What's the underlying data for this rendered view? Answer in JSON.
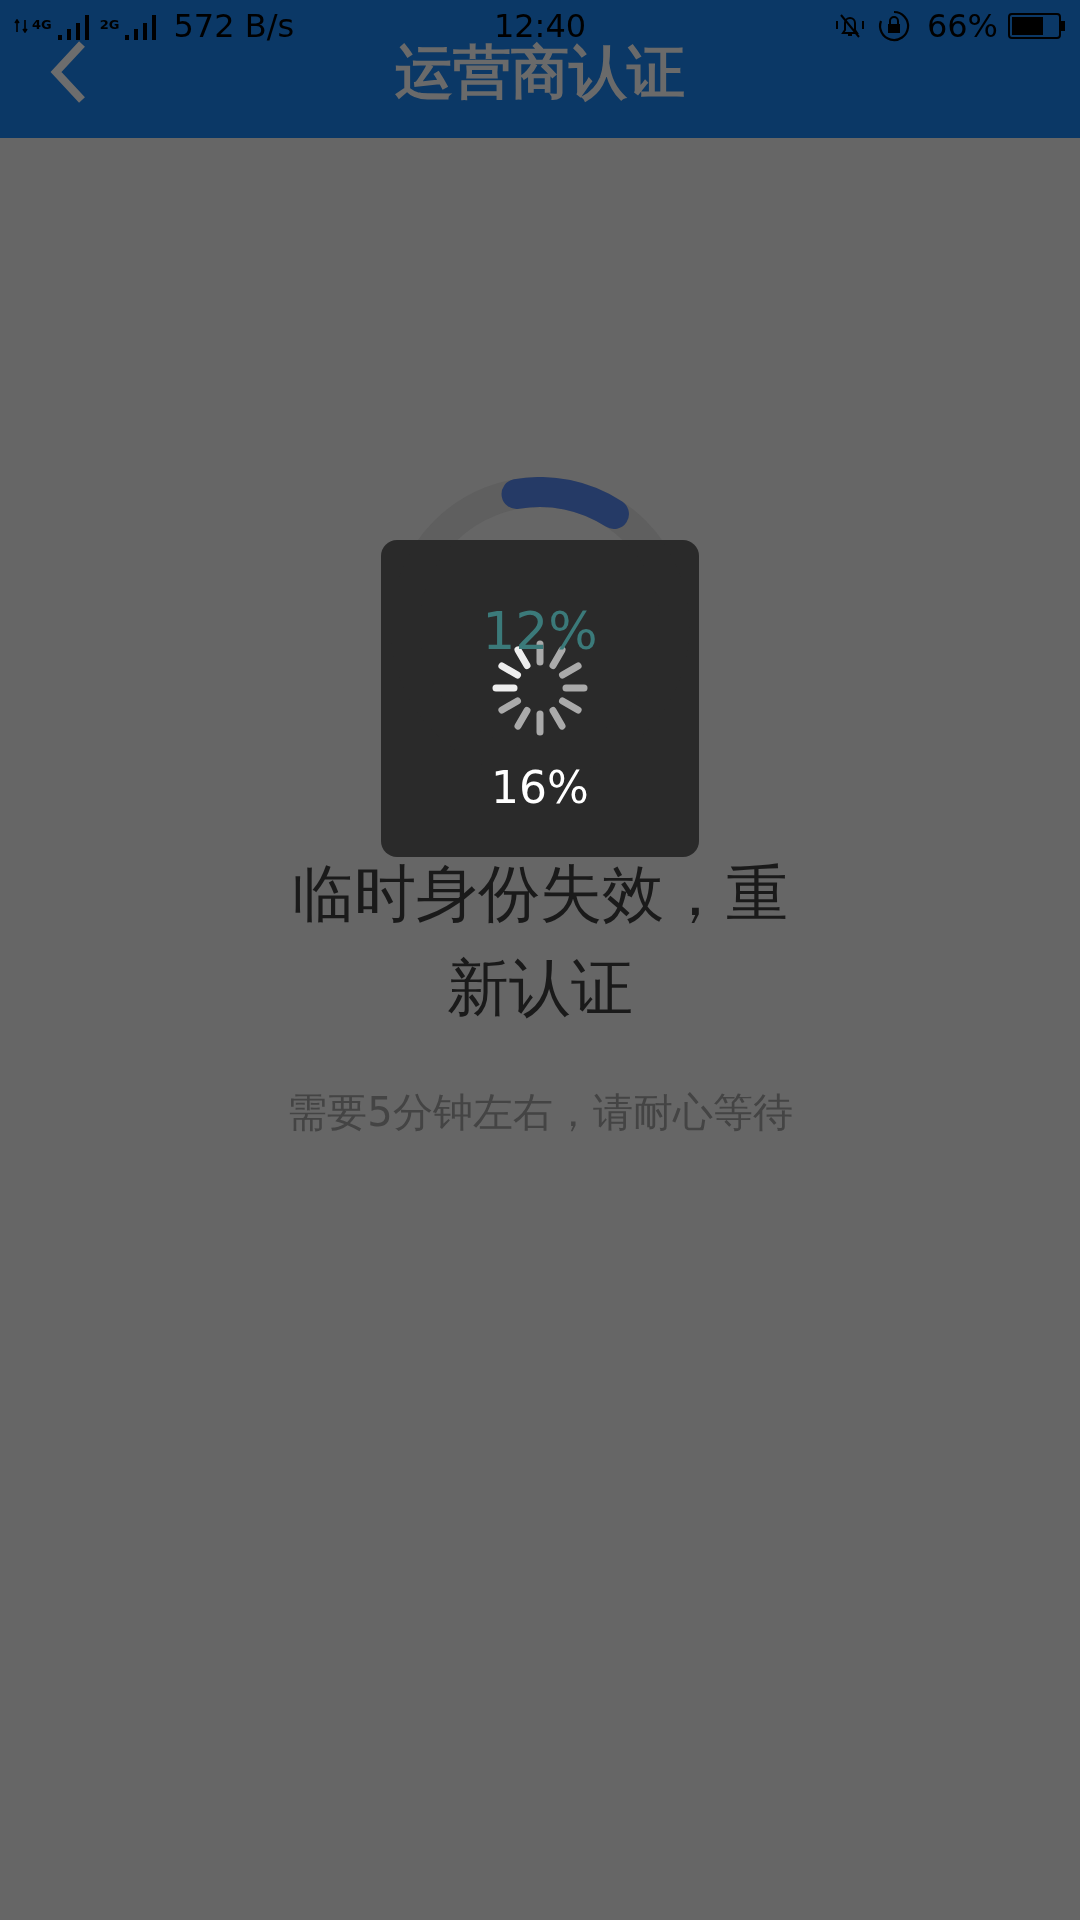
{
  "status_bar": {
    "network_1": "4G",
    "network_2": "2G",
    "speed": "572 B/s",
    "time": "12:40",
    "battery": "66%"
  },
  "header": {
    "title": "运营商认证"
  },
  "progress": {
    "level": 0.12,
    "percent": "12%"
  },
  "loading_toast": {
    "percent": "16%"
  },
  "message": {
    "title": "临时身份失效，重新认证",
    "subtitle": "需要5分钟左右，请耐心等待"
  }
}
